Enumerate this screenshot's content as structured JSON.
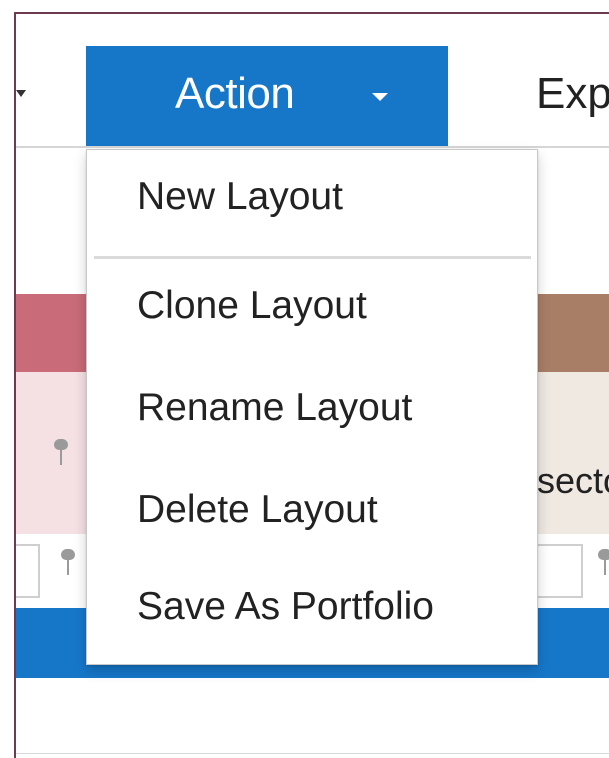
{
  "toolbar": {
    "action_button": {
      "label": "Action"
    },
    "next_menu_label": "Exp",
    "colors": {
      "action_background": "#1677c9",
      "toolbar_divider": "#d6d6d6"
    }
  },
  "dropdown": {
    "items": [
      {
        "label": "New Layout"
      },
      {
        "label": "Clone Layout"
      },
      {
        "label": "Rename Layout"
      },
      {
        "label": "Delete Layout"
      },
      {
        "label": "Save As Portfolio"
      }
    ]
  },
  "background": {
    "right_panel_text": "secto",
    "colors": {
      "left_band": "#c96b78",
      "right_band": "#a87e67",
      "left_panel": "#f5e1e4",
      "right_panel": "#efe9e2",
      "blue_bar": "#1677c9"
    }
  },
  "icons": {
    "left_caret": "chevron-down-icon",
    "action_caret": "chevron-down-icon",
    "pin": "pin-icon"
  }
}
